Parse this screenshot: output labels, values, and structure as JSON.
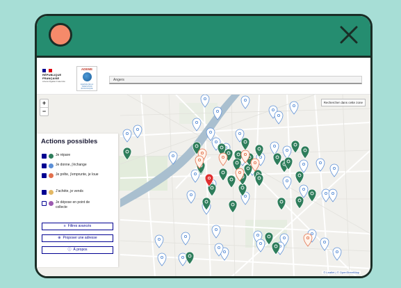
{
  "colors": {
    "background": "#a7ded6",
    "titlebar": "#258d70",
    "window_dot": "#f58a6a",
    "outline": "#1a2d26",
    "map_bg": "#f1f0ec",
    "river": "#a9bfcf",
    "pin_green": "#2e7d5b",
    "pin_blue": "#ffffff",
    "pin_selected": "#e03030",
    "dsfr_blue": "#000091"
  },
  "window": {
    "dot_icon": "window-dot",
    "close_icon": "close-x-icon"
  },
  "header": {
    "rf_logo": {
      "line1": "RÉPUBLIQUE",
      "line2": "FRANÇAISE",
      "motto": "Liberté Égalité Fraternité"
    },
    "ademe_logo": {
      "word": "ADEME",
      "tagline": "AGENCE DE LA TRANSITION ÉCOLOGIQUE"
    },
    "search": {
      "value": "Angers",
      "placeholder": ""
    }
  },
  "map": {
    "zoom_in": "+",
    "zoom_out": "−",
    "search_area_button": "Rechercher dans cette zone",
    "attribution": "© Leaflet | © OpenStreetMap"
  },
  "panel": {
    "title": "Actions possibles",
    "actions": [
      {
        "label": "Je répare",
        "checked": true,
        "icon": "repair-icon",
        "color": "#2e7d5b"
      },
      {
        "label": "Je donne, j'échange",
        "checked": true,
        "icon": "give-icon",
        "color": "#5b8fd6"
      },
      {
        "label": "Je prête, j'emprunte, je loue",
        "checked": true,
        "icon": "lend-icon",
        "color": "#e2704c"
      },
      {
        "label": "J'achète, je vends",
        "checked": true,
        "icon": "buy-icon",
        "color": "#e3b864"
      },
      {
        "label": "Je dépose en point de collecte",
        "checked": false,
        "icon": "drop-off-icon",
        "color": "#9c5ab0"
      }
    ],
    "buttons": [
      {
        "label": "Filtres avancés",
        "icon": "filter-icon",
        "glyph": "≡"
      },
      {
        "label": "Proposer une adresse",
        "icon": "add-icon",
        "glyph": "⊕"
      },
      {
        "label": "À propos",
        "icon": "info-icon",
        "glyph": "ⓘ"
      }
    ]
  }
}
